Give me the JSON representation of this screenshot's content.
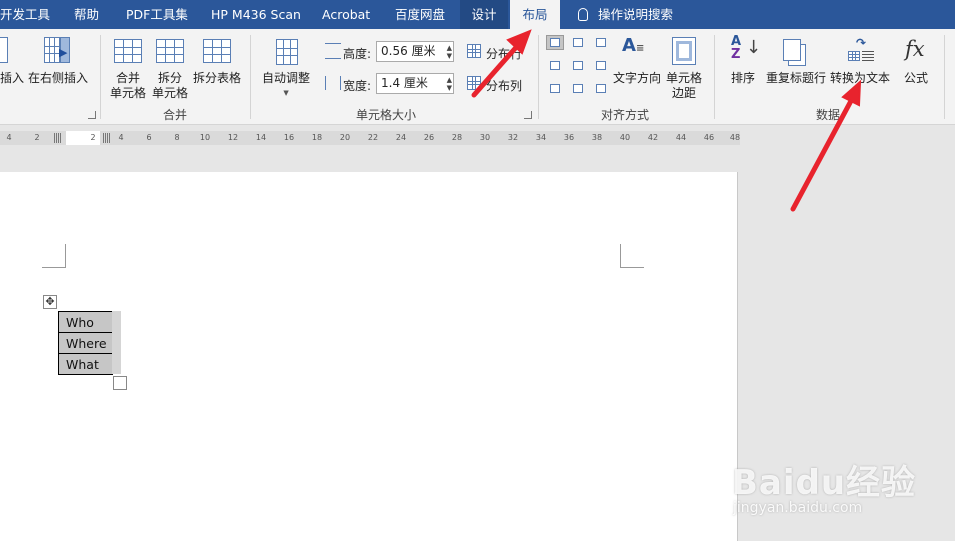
{
  "tabs": {
    "dev_tools": "开发工具",
    "help": "帮助",
    "pdf": "PDF工具集",
    "hp": "HP M436 Scan",
    "acrobat": "Acrobat",
    "baidu": "百度网盘",
    "design": "设计",
    "layout": "布局",
    "tell_me": "操作说明搜索"
  },
  "ribbon": {
    "insert_below_partial": "插入",
    "insert_right": "在右侧插入",
    "merge_cells_1": "合并",
    "merge_cells_2": "单元格",
    "split_cells_1": "拆分",
    "split_cells_2": "单元格",
    "split_table": "拆分表格",
    "group_merge": "合并",
    "autofit": "自动调整",
    "height_label": "高度:",
    "height_value": "0.56 厘米",
    "width_label": "宽度:",
    "width_value": "1.4 厘米",
    "distribute_rows": "分布行",
    "distribute_cols": "分布列",
    "group_cell_size": "单元格大小",
    "text_direction": "文字方向",
    "cell_margins_1": "单元格",
    "cell_margins_2": "边距",
    "group_alignment": "对齐方式",
    "sort": "排序",
    "repeat_header": "重复标题行",
    "convert_to_text": "转换为文本",
    "formula": "公式",
    "group_data": "数据"
  },
  "ruler": [
    "4",
    "2",
    "2",
    "4",
    "6",
    "8",
    "10",
    "12",
    "14",
    "16",
    "18",
    "20",
    "22",
    "24",
    "26",
    "28",
    "30",
    "32",
    "34",
    "36",
    "38",
    "40",
    "42",
    "44",
    "46",
    "48"
  ],
  "table": {
    "rows": [
      "Who",
      "Where",
      "What"
    ]
  },
  "watermark": {
    "brand": "Baidu经验",
    "url": "jingyan.baidu.com"
  },
  "colors": {
    "tab_bar": "#2b579a",
    "arrow": "#e8232d"
  }
}
